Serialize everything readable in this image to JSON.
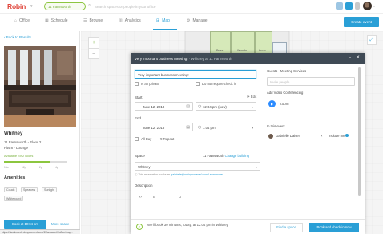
{
  "app": {
    "logo": "Robin",
    "location": "11 Farnsworth",
    "search_placeholder": "Search spaces or people in your office"
  },
  "nav": {
    "items": [
      {
        "label": "Office",
        "icon": "home-icon"
      },
      {
        "label": "Schedule",
        "icon": "calendar-icon"
      },
      {
        "label": "Browse",
        "icon": "browse-icon"
      },
      {
        "label": "Analytics",
        "icon": "analytics-icon"
      },
      {
        "label": "Map",
        "icon": "map-icon"
      },
      {
        "label": "Manage",
        "icon": "gear-icon"
      }
    ],
    "active": "Map",
    "create_label": "Create event"
  },
  "left_panel": {
    "back_label": "‹ Back to Results",
    "room_name": "Whitney",
    "address_lines": [
      "11 Farnsworth - Floor 2",
      "Fits 8 - Lounge"
    ],
    "availability_label": "Available for 2 hours",
    "availability_fraction": 0.75,
    "ticks": [
      "10a",
      "12p",
      "2p",
      "4p"
    ],
    "amenities_title": "Amenities",
    "amenities": [
      "Couch",
      "Speakers",
      "Sunlight",
      "Whiteboard"
    ],
    "book_label": "Book at 10:04 pm",
    "more_label": "More space"
  },
  "map": {
    "rooms": [
      "Buzz",
      "Woods",
      "Lena"
    ],
    "zoom_in": "+",
    "zoom_out": "−"
  },
  "modal": {
    "title": "Very important business meeting!",
    "subtitle": "· Whitney at 11 Farnsworth",
    "title_value": "Very important business meeting!",
    "check_private": "Is an private",
    "check_nocheckin": "Do not require check in",
    "start_label": "Start",
    "end_label": "End",
    "edit_label": "Edit",
    "start_date": "June 12, 2018",
    "start_time": "12:04 pm (now)",
    "end_date": "June 12, 2018",
    "end_time": "1:04 pm",
    "allday_label": "All Day",
    "repeat_label": "Repeat",
    "space_label": "Space",
    "space_location": "11 Farnsworth",
    "space_change": "Change building",
    "space_value": "Whitney",
    "notice_text": "This reservation books as",
    "notice_email": "gabrielle@robinpowered.com",
    "notice_learn": "Learn more",
    "description_label": "Description",
    "editor_tools": [
      "‹›",
      "B",
      "I",
      "U"
    ],
    "guests_label": "Guests",
    "guests_sublabel": "Meeting Services",
    "guests_placeholder": "Invite people",
    "video_label": "Add Video Conferencing",
    "zoom_label": "Zoom",
    "in_event_label": "In this event",
    "guest_name": "Gabrielle Daisen",
    "guest_include": "Include me",
    "footer_msg": "We'll book 30 minutes, today, at 12:04 pm in Whitney",
    "find_space": "Find a space",
    "book_button": "Book and check in now",
    "colors": {
      "header": "#3f4a55",
      "accent": "#2a9fd6",
      "success": "#7cb342"
    }
  },
  "status_url": "https://dashboard.robinpowered.com/11farnsworth/office/map..."
}
